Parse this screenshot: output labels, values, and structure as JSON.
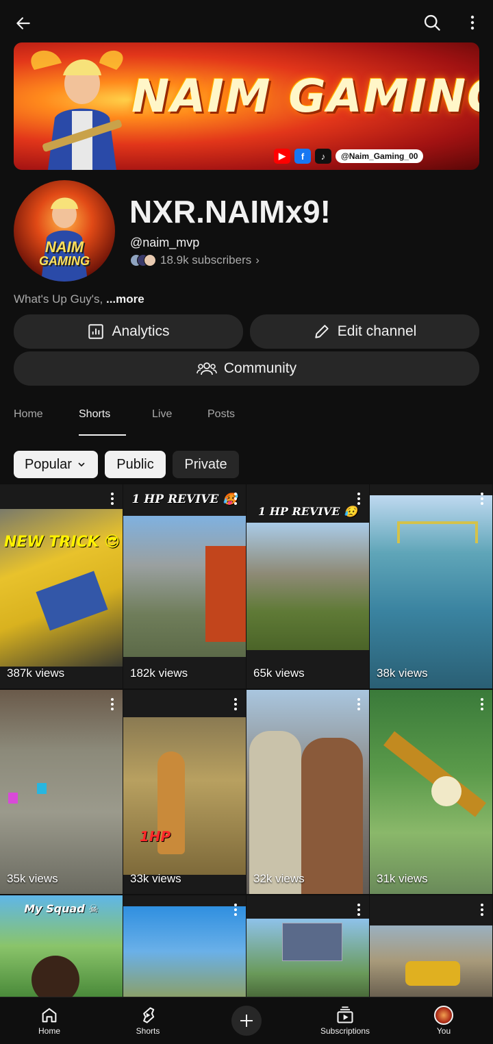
{
  "header": {
    "back_icon": "arrow-left-icon",
    "search_icon": "search-icon",
    "menu_icon": "more-vert-icon"
  },
  "banner": {
    "title": "NAIM GAMING",
    "social_handle": "@Naim_Gaming_00",
    "social_icons": [
      "youtube-icon",
      "facebook-icon",
      "tiktok-icon"
    ]
  },
  "channel": {
    "avatar_text_line1": "NAIM",
    "avatar_text_line2": "GAMING",
    "name": "NXR.NAIMx9!",
    "handle": "@naim_mvp",
    "subscribers": "18.9k subscribers",
    "subscribers_chevron": "›",
    "description": "What's Up Guy's,",
    "more": "...more"
  },
  "actions": {
    "analytics_label": "Analytics",
    "edit_label": "Edit channel",
    "community_label": "Community"
  },
  "tabs": [
    {
      "label": "Home",
      "active": false
    },
    {
      "label": "Shorts",
      "active": true
    },
    {
      "label": "Live",
      "active": false
    },
    {
      "label": "Posts",
      "active": false
    }
  ],
  "filters": {
    "popular": "Popular",
    "public": "Public",
    "private": "Private"
  },
  "shorts": [
    {
      "views": "387k views",
      "caption": "NEW TRICK 😎"
    },
    {
      "views": "182k views",
      "caption": "1 HP REVIVE 🥵"
    },
    {
      "views": "65k views",
      "caption": "1 HP REVIVE 😥"
    },
    {
      "views": "38k views",
      "caption": ""
    },
    {
      "views": "35k views",
      "caption": ""
    },
    {
      "views": "33k views",
      "caption": "1HP"
    },
    {
      "views": "32k views",
      "caption": ""
    },
    {
      "views": "31k views",
      "caption": ""
    },
    {
      "views": "",
      "caption": "My Squad ☠"
    },
    {
      "views": "",
      "caption": ""
    },
    {
      "views": "",
      "caption": ""
    },
    {
      "views": "",
      "caption": ""
    }
  ],
  "bottom_nav": {
    "home": "Home",
    "shorts": "Shorts",
    "subscriptions": "Subscriptions",
    "you": "You"
  }
}
